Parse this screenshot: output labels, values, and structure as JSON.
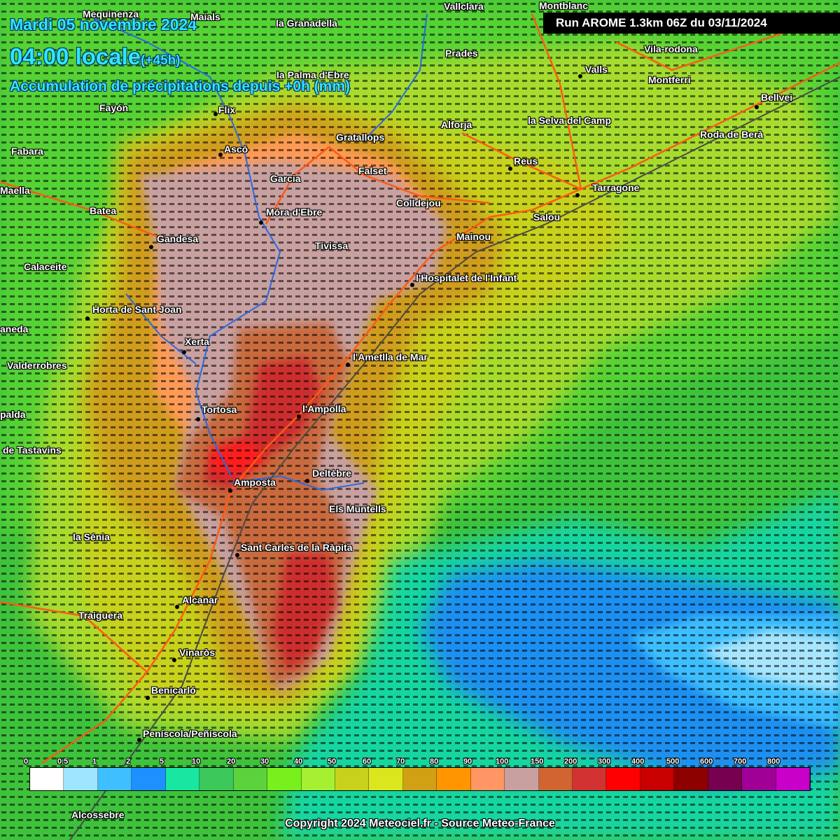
{
  "header": {
    "date": "Mardi 05 novembre 2024",
    "time": "04:00 locale",
    "offset": "(+45h)",
    "title": "Accumulation de précipitations depuis +0h (mm)"
  },
  "run": "Run AROME 1.3km 06Z du 03/11/2024",
  "copyright": "Copyright 2024 Meteociel.fr - Source Meteo-France",
  "towns": [
    {
      "key": "mequinenza",
      "name": "Mequinenza"
    },
    {
      "key": "maials",
      "name": "Maials"
    },
    {
      "key": "granadella",
      "name": "la Granadella"
    },
    {
      "key": "vallclara",
      "name": "Vallclara"
    },
    {
      "key": "montblanc",
      "name": "Montblanc"
    },
    {
      "key": "prades",
      "name": "Prades"
    },
    {
      "key": "vilarodona",
      "name": "Vila-rodona"
    },
    {
      "key": "valls",
      "name": "Valls"
    },
    {
      "key": "palma",
      "name": "la Palma d'Ebre"
    },
    {
      "key": "montferri",
      "name": "Montferri"
    },
    {
      "key": "bellvei",
      "name": "Bellvei"
    },
    {
      "key": "fayon",
      "name": "Fayón"
    },
    {
      "key": "flix",
      "name": "Flix"
    },
    {
      "key": "selva",
      "name": "la Selva del Camp"
    },
    {
      "key": "alforja",
      "name": "Alforja"
    },
    {
      "key": "roda",
      "name": "Roda de Berà"
    },
    {
      "key": "fabara",
      "name": "Fabara"
    },
    {
      "key": "asco",
      "name": "Ascó"
    },
    {
      "key": "gratallops",
      "name": "Gratallops"
    },
    {
      "key": "reus",
      "name": "Reus"
    },
    {
      "key": "falset",
      "name": "Falset"
    },
    {
      "key": "garcia",
      "name": "Garcia"
    },
    {
      "key": "tarragone",
      "name": "Tarragone"
    },
    {
      "key": "maella",
      "name": "Maella"
    },
    {
      "key": "colldejou",
      "name": "Colldejou"
    },
    {
      "key": "batea",
      "name": "Batea"
    },
    {
      "key": "mora",
      "name": "Móra d'Ebre"
    },
    {
      "key": "salou",
      "name": "Salou"
    },
    {
      "key": "mainou",
      "name": "Mainou"
    },
    {
      "key": "gandesa",
      "name": "Gandesa"
    },
    {
      "key": "tivissa",
      "name": "Tivissa"
    },
    {
      "key": "calaceite",
      "name": "Calaceite"
    },
    {
      "key": "hospitalet",
      "name": "l'Hospitalet de l'Infant"
    },
    {
      "key": "horta",
      "name": "Horta de Sant Joan"
    },
    {
      "key": "cretas",
      "name": "aneda"
    },
    {
      "key": "xerta",
      "name": "Xerta"
    },
    {
      "key": "ametlla",
      "name": "l'Ametlla de Mar"
    },
    {
      "key": "valderrobres",
      "name": "Valderrobres"
    },
    {
      "key": "tortosa",
      "name": "Tortosa"
    },
    {
      "key": "ampolla",
      "name": "l'Ampolla"
    },
    {
      "key": "penarroya",
      "name": "palda"
    },
    {
      "key": "tastavins",
      "name": "de Tastavins"
    },
    {
      "key": "deltebre",
      "name": "Deltèbre"
    },
    {
      "key": "amposta",
      "name": "Amposta"
    },
    {
      "key": "muntells",
      "name": "Els Muntells"
    },
    {
      "key": "senia",
      "name": "la Sénia"
    },
    {
      "key": "rapita",
      "name": "Sant Carles de la Ràpita"
    },
    {
      "key": "alcanar",
      "name": "Alcanar"
    },
    {
      "key": "traiguera",
      "name": "Traiguera"
    },
    {
      "key": "vinaros",
      "name": "Vinaròs"
    },
    {
      "key": "benicarlo",
      "name": "Benicarló"
    },
    {
      "key": "peniscola",
      "name": "Peníscola/Peñíscola"
    },
    {
      "key": "alcossebre",
      "name": "Alcossebre"
    }
  ],
  "legend": {
    "unit": "mm",
    "thresholds": [
      "0",
      "0.5",
      "1",
      "2",
      "5",
      "10",
      "20",
      "30",
      "40",
      "50",
      "60",
      "70",
      "80",
      "90",
      "100",
      "150",
      "200",
      "300",
      "400",
      "500",
      "600",
      "700",
      "800"
    ],
    "colors": [
      "#ffffff",
      "#9ee6ff",
      "#3fbfff",
      "#1e90ff",
      "#19e6a0",
      "#3cc85a",
      "#5cd23c",
      "#78f01e",
      "#a6f032",
      "#c8d21e",
      "#dce61e",
      "#d2a014",
      "#ff9600",
      "#ff9664",
      "#c8a0a0",
      "#d26432",
      "#d23232",
      "#ff0000",
      "#c80000",
      "#8c0000",
      "#780050",
      "#a00096",
      "#c800c8"
    ]
  }
}
